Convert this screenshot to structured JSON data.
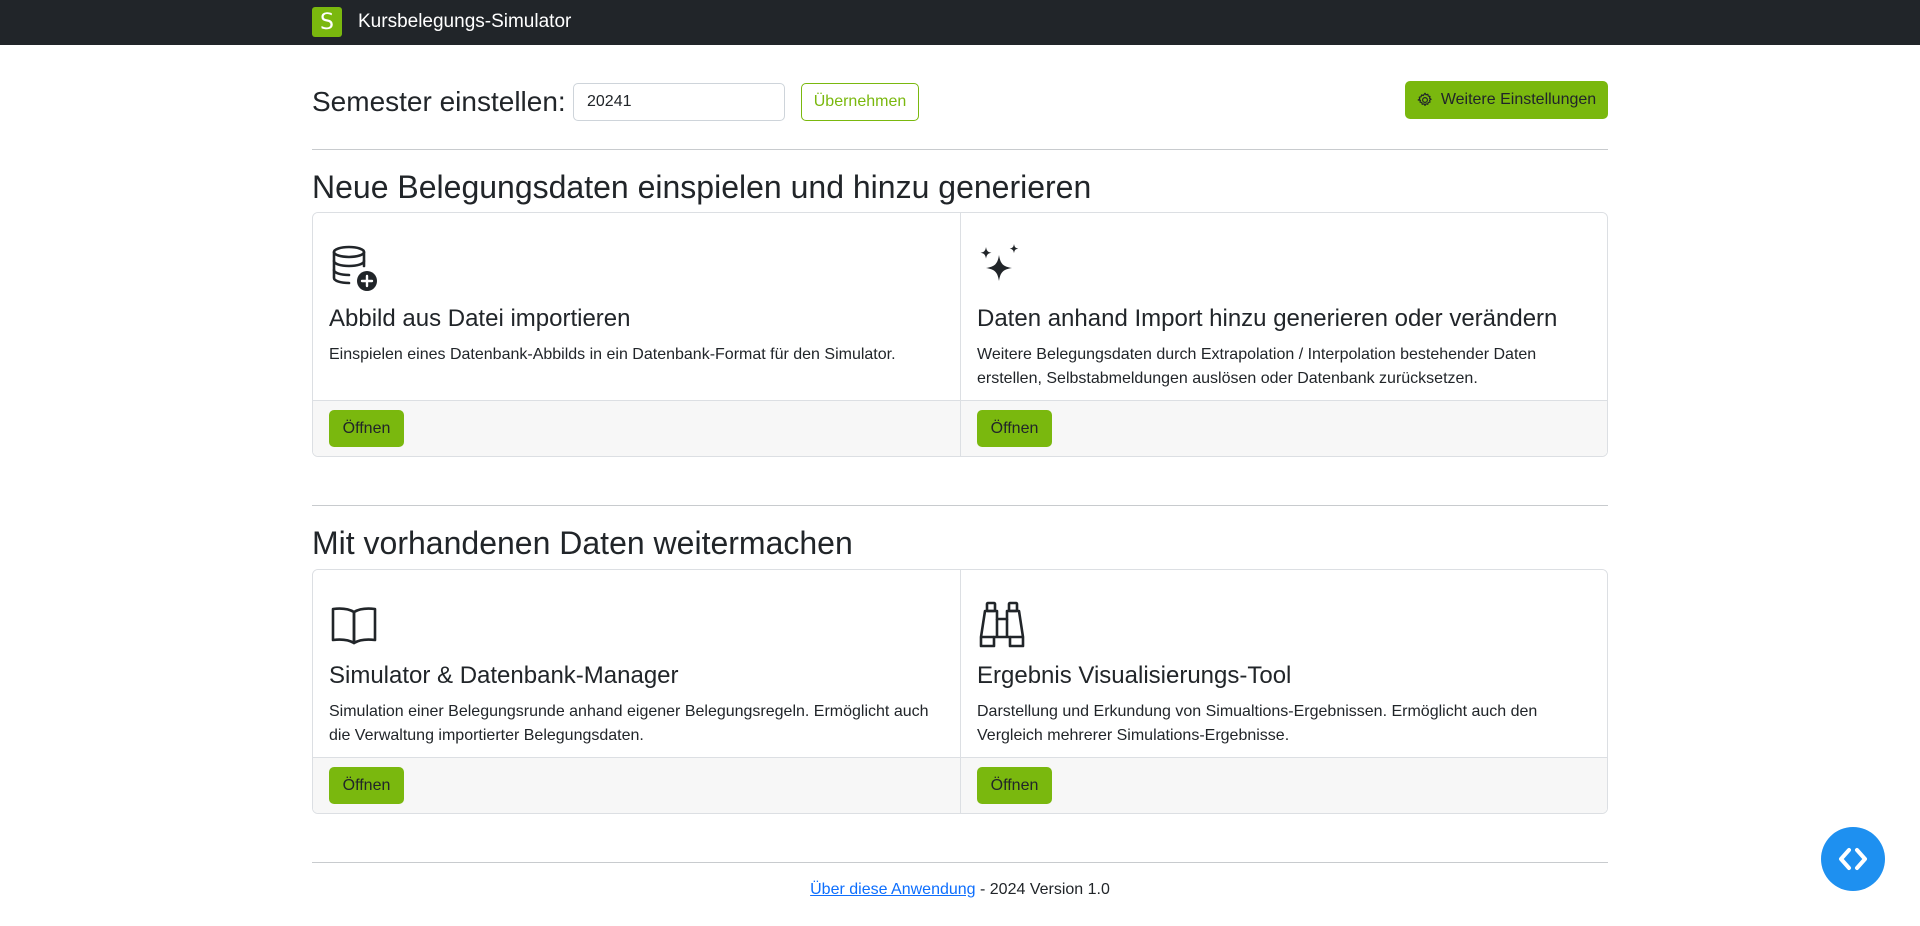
{
  "navbar": {
    "logo_letter": "S",
    "title": "Kursbelegungs-Simulator"
  },
  "semester": {
    "label": "Semester einstellen:",
    "value": "20241",
    "apply_label": "Übernehmen",
    "settings_label": "Weitere Einstellungen"
  },
  "sections": [
    {
      "title": "Neue Belegungsdaten einspielen und hinzu generieren",
      "cards": [
        {
          "icon": "database-add-icon",
          "title": "Abbild aus Datei importieren",
          "text": "Einspielen eines Datenbank-Abbilds in ein Datenbank-Format für den Simulator.",
          "button": "Öffnen"
        },
        {
          "icon": "stars-icon",
          "title": "Daten anhand Import hinzu generieren oder verändern",
          "text": "Weitere Belegungsdaten durch Extrapolation / Interpolation bestehender Daten erstellen, Selbstabmeldungen auslösen oder Datenbank zurücksetzen.",
          "button": "Öffnen"
        }
      ]
    },
    {
      "title": "Mit vorhandenen Daten weitermachen",
      "cards": [
        {
          "icon": "book-icon",
          "title": "Simulator & Datenbank-Manager",
          "text": "Simulation einer Belegungsrunde anhand eigener Belegungsregeln. Ermöglicht auch die Verwaltung importierter Belegungsdaten.",
          "button": "Öffnen"
        },
        {
          "icon": "binoculars-icon",
          "title": "Ergebnis Visualisierungs-Tool",
          "text": "Darstellung und Erkundung von Simualtions-Ergebnissen. Ermöglicht auch den Vergleich mehrerer Simulations-Ergebnisse.",
          "button": "Öffnen"
        }
      ]
    }
  ],
  "footer": {
    "link_text": "Über diese Anwendung",
    "suffix": " - 2024 Version 1.0"
  },
  "colors": {
    "accent": "#7ab80e",
    "navbar": "#212529",
    "fab": "#1e90f0",
    "link": "#0d6efd"
  },
  "fab": {
    "icon": "code-icon"
  }
}
